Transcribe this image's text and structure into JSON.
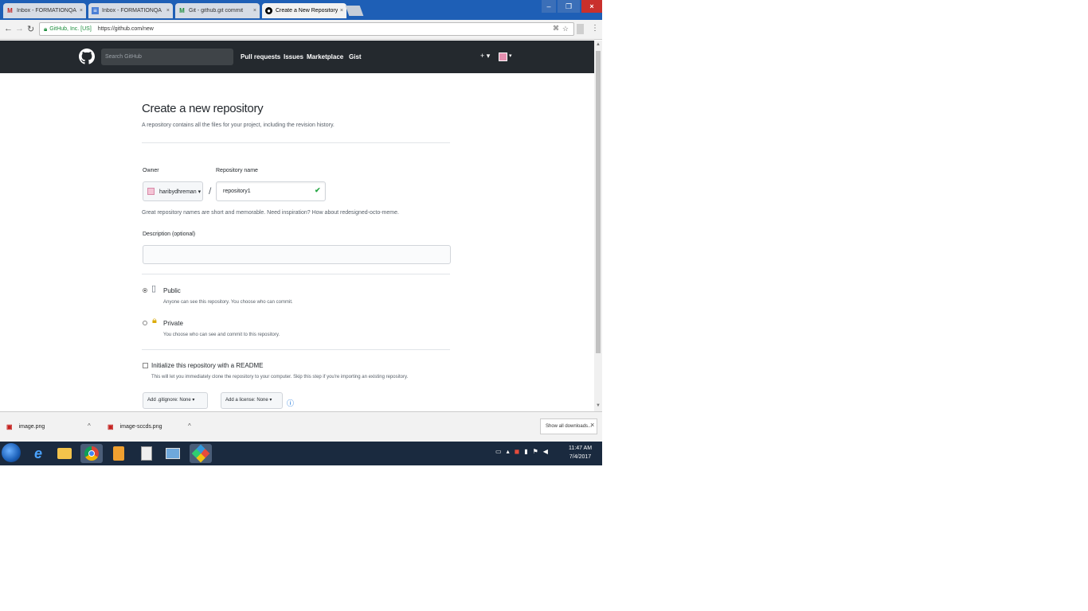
{
  "browser": {
    "tabs": [
      {
        "label": "Inbox - FORMATIONQA",
        "icon": "gmail-icon",
        "active": false
      },
      {
        "label": "Inbox - FORMATIONQA",
        "icon": "docs-icon",
        "active": false
      },
      {
        "label": "Git - github.git commit",
        "icon": "git-icon",
        "active": false
      },
      {
        "label": "Create a New Repository",
        "icon": "github-icon",
        "active": true
      }
    ],
    "tab_close": "×",
    "win_min": "–",
    "win_max": "❐",
    "win_close": "×",
    "back": "←",
    "forward": "→",
    "reload": "↻",
    "secure_label": "GitHub, Inc. [US]",
    "url": "https://github.com/new",
    "menu": "⋮"
  },
  "github": {
    "search_placeholder": "Search GitHub",
    "nav": [
      "Pull requests",
      "Issues",
      "Marketplace",
      "Gist"
    ],
    "plus": "+ ▾",
    "avatar_caret": "▾"
  },
  "form": {
    "title": "Create a new repository",
    "subtitle": "A repository contains all the files for your project, including the revision history.",
    "owner_label": "Owner",
    "owner_value": "haribydhreman ▾",
    "slash": "/",
    "repo_name_label": "Repository name",
    "repo_name_value": "repository1",
    "check": "✔",
    "hint": "Great repository names are short and memorable. Need inspiration? How about redesigned-octo-meme.",
    "description_label": "Description (optional)",
    "public_title": "Public",
    "public_desc": "Anyone can see this repository. You choose who can commit.",
    "private_title": "Private",
    "private_desc": "You choose who can see and commit to this repository.",
    "init_title": "Initialize this repository with a README",
    "init_desc": "This will let you immediately clone the repository to your computer. Skip this step if you're importing an existing repository.",
    "gitignore_btn": "Add .gitignore: None ▾",
    "license_btn": "Add a license: None ▾",
    "info": "ⓘ"
  },
  "downloads": {
    "items": [
      "image.png",
      "image-sccds.png"
    ],
    "caret": "^",
    "show_all": "Show all downloads...",
    "close": "×"
  },
  "taskbar": {
    "clock_time": "11:47 AM",
    "clock_date": "7/4/2017"
  }
}
